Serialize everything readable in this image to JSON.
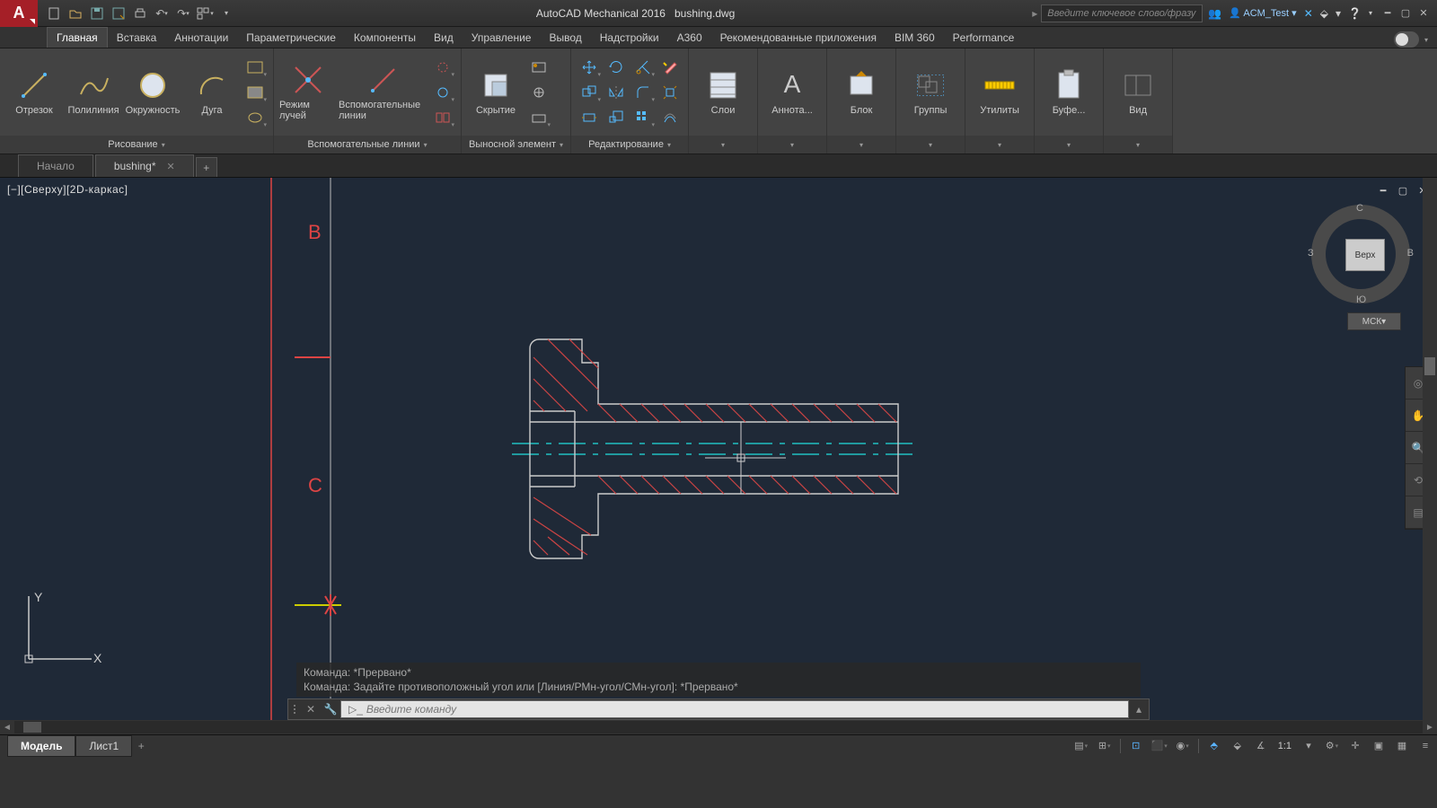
{
  "title": {
    "app": "AutoCAD Mechanical 2016",
    "file": "bushing.dwg"
  },
  "search": {
    "placeholder": "Введите ключевое слово/фразу"
  },
  "signin": {
    "label": "ACM_Test"
  },
  "ribbon_tabs": [
    "Главная",
    "Вставка",
    "Аннотации",
    "Параметрические",
    "Компоненты",
    "Вид",
    "Управление",
    "Вывод",
    "Надстройки",
    "A360",
    "Рекомендованные приложения",
    "BIM 360",
    "Performance"
  ],
  "active_ribbon_tab": 0,
  "panels": {
    "draw": {
      "title": "Рисование",
      "btns": {
        "line": "Отрезок",
        "polyline": "Полилиния",
        "circle": "Окружность",
        "arc": "Дуга"
      }
    },
    "construct": {
      "title": "Вспомогательные линии",
      "btns": {
        "ray_mode": "Режим лучей",
        "construction": "Вспомогательные линии"
      }
    },
    "detail": {
      "title": "Выносной элемент",
      "btns": {
        "hide": "Скрытие"
      }
    },
    "modify": {
      "title": "Редактирование"
    },
    "layers": {
      "title": "Слои"
    },
    "annot": {
      "title": "Аннота..."
    },
    "block": {
      "title": "Блок"
    },
    "groups": {
      "title": "Группы"
    },
    "utils": {
      "title": "Утилиты"
    },
    "clip": {
      "title": "Буфе..."
    },
    "view": {
      "title": "Вид"
    }
  },
  "file_tabs": {
    "start": "Начало",
    "doc": "bushing*",
    "add": "+"
  },
  "viewport": {
    "label": "[−][Сверху][2D-каркас]"
  },
  "viewcube": {
    "top": "Верх",
    "n": "С",
    "s": "Ю",
    "e": "В",
    "w": "З",
    "cs": "МСК"
  },
  "cmd": {
    "hist1": "Команда: *Прервано*",
    "hist2": "Команда: Задайте противоположный угол или [Линия/РМн-угол/СМн-угол]: *Прервано*",
    "placeholder": "Введите команду"
  },
  "layout_tabs": {
    "model": "Модель",
    "sheet1": "Лист1"
  },
  "status": {
    "scale": "1:1"
  },
  "drawing_labels": {
    "B": "B",
    "C": "C"
  },
  "ucs": {
    "x": "X",
    "y": "Y"
  }
}
